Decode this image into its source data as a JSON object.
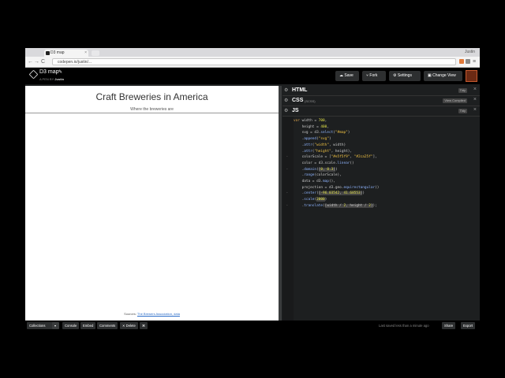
{
  "browser": {
    "tab_title": "D3 map",
    "tab_close": "×",
    "user_label": "Justin",
    "url": "codepen.io/justin/...",
    "nav": {
      "back": "←",
      "forward": "→",
      "reload": "C",
      "home": "⌂"
    }
  },
  "codepen": {
    "pen_title": "D3 map",
    "pencil": "✎",
    "byline_prefix": "A PEN BY",
    "author": "Justin",
    "buttons": {
      "save": "Save",
      "fork": "Fork",
      "settings": "Settings",
      "change_view": "Change View"
    },
    "icons": {
      "save": "☁",
      "fork": "⑂",
      "settings": "⚙",
      "change_view": "▣"
    }
  },
  "preview": {
    "title": "Craft Breweries in America",
    "subtitle": "Where the breweries are",
    "source_prefix": "Sources:",
    "source_link": "The Brewers Association, data"
  },
  "panes": {
    "html": {
      "name": "HTML",
      "tidy": "Tidy"
    },
    "css": {
      "name": "CSS",
      "preprocessor": "(SCSS)",
      "view_compiled": "View Compiled"
    },
    "js": {
      "name": "JS",
      "tidy": "Tidy"
    }
  },
  "code_lines": [
    {
      "fold": "",
      "html": "<span class=\"kw\">var</span> width = <span class=\"num\">700</span>,"
    },
    {
      "fold": "",
      "html": "    height = <span class=\"num\">400</span>,"
    },
    {
      "fold": "",
      "html": "    svg = d3.<span class=\"fn\">select</span>(<span class=\"str\">\"#map\"</span>)"
    },
    {
      "fold": "",
      "html": "    .<span class=\"fn\">append</span>(<span class=\"str\">\"svg\"</span>)"
    },
    {
      "fold": "",
      "html": "    .<span class=\"fn\">attr</span>(<span class=\"str\">\"width\"</span>, width)"
    },
    {
      "fold": "",
      "html": "    .<span class=\"fn\">attr</span>(<span class=\"str\">\"height\"</span>, height),"
    },
    {
      "fold": "-",
      "html": "    colorScale = [<span class=\"str\">\"#e5f5f9\"</span>, <span class=\"str\">\"#2ca25f\"</span>],"
    },
    {
      "fold": "",
      "html": "    color = d3.scale.<span class=\"fn\">linear</span>()"
    },
    {
      "fold": "-",
      "html": "    .<span class=\"fn\">domain</span>(<span class=\"hl\">[<span class=\"num\">0</span>, <span class=\"num\">0.3</span>]</span>)"
    },
    {
      "fold": "",
      "html": "    .<span class=\"fn\">range</span>(colorScale),"
    },
    {
      "fold": "",
      "html": "    data = d3.<span class=\"fn\">map</span>(),"
    },
    {
      "fold": "",
      "html": "    projection = d3.geo.<span class=\"fn\">equirectangular</span>()"
    },
    {
      "fold": "-",
      "html": "    .<span class=\"fn\">center</span>(<span class=\"hl\">[<span class=\"num\">-96.03542</span>, <span class=\"num\">41.68553</span>]</span>)"
    },
    {
      "fold": "",
      "html": "    .<span class=\"fn\">scale</span>(<span class=\"hl\"><span class=\"num\">2000</span></span>)"
    },
    {
      "fold": "-",
      "html": "    .<span class=\"fn\">translate</span>(<span class=\"hl\">[width / <span class=\"num\">2</span>, height / <span class=\"num\">2</span>]</span>);"
    }
  ],
  "footer": {
    "collections": "Collections",
    "console": "Console",
    "embed": "Embed",
    "comments": "Comments",
    "delete": "✕ Delete",
    "keyboard": "⌘",
    "saved_text": "Last saved less than a minute ago",
    "share": "Share",
    "export": "Export"
  },
  "colors": {
    "background": "#000000",
    "editor": "#1d1f20",
    "preview": "#ffffff",
    "link": "#2a6cc8"
  }
}
